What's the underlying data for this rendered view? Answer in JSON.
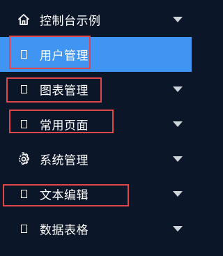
{
  "menu": {
    "items": [
      {
        "label": "控制台示例",
        "icon": "home-icon",
        "has_submenu": true,
        "active": false
      },
      {
        "label": "用户管理",
        "icon": "document-icon",
        "has_submenu": false,
        "active": true
      },
      {
        "label": "图表管理",
        "icon": "document-icon",
        "has_submenu": true,
        "active": false
      },
      {
        "label": "常用页面",
        "icon": "document-icon",
        "has_submenu": true,
        "active": false
      },
      {
        "label": "系统管理",
        "icon": "gear-icon",
        "has_submenu": true,
        "active": false
      },
      {
        "label": "文本编辑",
        "icon": "document-icon",
        "has_submenu": true,
        "active": false
      },
      {
        "label": "数据表格",
        "icon": "document-icon",
        "has_submenu": true,
        "active": false
      }
    ]
  },
  "colors": {
    "background": "#0b1728",
    "active": "#3f95f1",
    "text": "#ffffff",
    "chevron": "#cfd4da",
    "annotation_box": "#e0454a"
  }
}
